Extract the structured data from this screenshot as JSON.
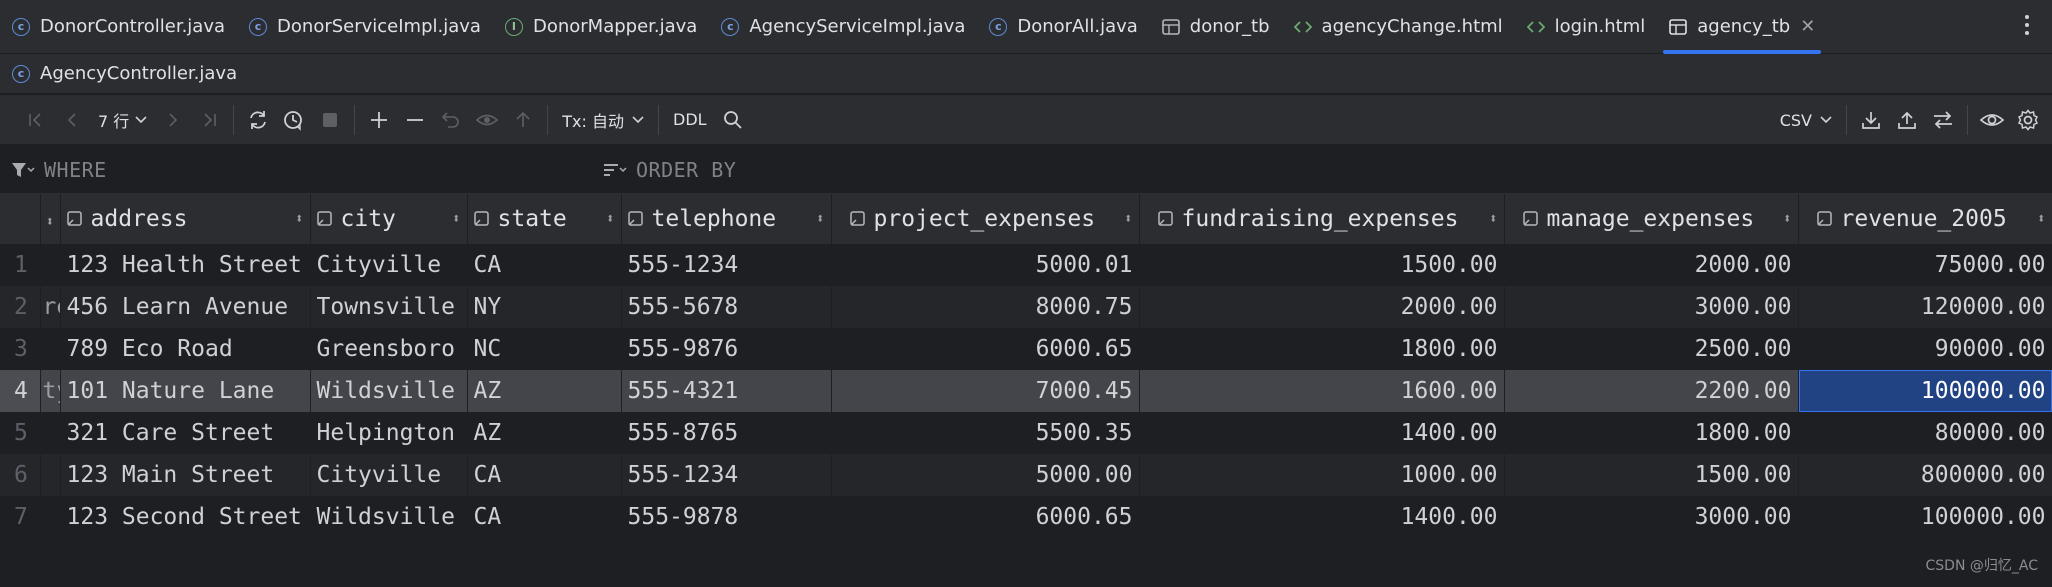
{
  "tabs": [
    {
      "label": "DonorController.java",
      "icon": "class-icon"
    },
    {
      "label": "DonorServiceImpl.java",
      "icon": "class-icon"
    },
    {
      "label": "DonorMapper.java",
      "icon": "interface-icon"
    },
    {
      "label": "AgencyServiceImpl.java",
      "icon": "class-icon"
    },
    {
      "label": "DonorAll.java",
      "icon": "class-icon"
    },
    {
      "label": "donor_tb",
      "icon": "table-icon"
    },
    {
      "label": "agencyChange.html",
      "icon": "html-icon"
    },
    {
      "label": "login.html",
      "icon": "html-icon"
    },
    {
      "label": "agency_tb",
      "icon": "table-icon",
      "active": true
    }
  ],
  "tabs_row2": [
    {
      "label": "AgencyController.java",
      "icon": "class-icon"
    }
  ],
  "toolbar": {
    "rows_label": "7 行",
    "tx_label": "Tx: 自动",
    "ddl_label": "DDL",
    "export_format": "CSV"
  },
  "filter": {
    "where_placeholder": "WHERE",
    "orderby_placeholder": "ORDER BY"
  },
  "table": {
    "columns": [
      "address",
      "city",
      "state",
      "telephone",
      "project_expenses",
      "fundraising_expenses",
      "manage_expenses",
      "revenue_2005"
    ],
    "rows": [
      {
        "n": "1",
        "hidden": "",
        "address": "123 Health Street",
        "city": "Cityville",
        "state": "CA",
        "telephone": "555-1234",
        "project_expenses": "5000.01",
        "fundraising_expenses": "1500.00",
        "manage_expenses": "2000.00",
        "revenue_2005": "75000.00"
      },
      {
        "n": "2",
        "hidden": "re",
        "address": "456 Learn Avenue",
        "city": "Townsville",
        "state": "NY",
        "telephone": "555-5678",
        "project_expenses": "8000.75",
        "fundraising_expenses": "2000.00",
        "manage_expenses": "3000.00",
        "revenue_2005": "120000.00"
      },
      {
        "n": "3",
        "hidden": "",
        "address": "789 Eco Road",
        "city": "Greensboro",
        "state": "NC",
        "telephone": "555-9876",
        "project_expenses": "6000.65",
        "fundraising_expenses": "1800.00",
        "manage_expenses": "2500.00",
        "revenue_2005": "90000.00"
      },
      {
        "n": "4",
        "hidden": "ty",
        "address": "101 Nature Lane",
        "city": "Wildsville",
        "state": "AZ",
        "telephone": "555-4321",
        "project_expenses": "7000.45",
        "fundraising_expenses": "1600.00",
        "manage_expenses": "2200.00",
        "revenue_2005": "100000.00"
      },
      {
        "n": "5",
        "hidden": "",
        "address": "321 Care Street",
        "city": "Helpington",
        "state": "AZ",
        "telephone": "555-8765",
        "project_expenses": "5500.35",
        "fundraising_expenses": "1400.00",
        "manage_expenses": "1800.00",
        "revenue_2005": "80000.00"
      },
      {
        "n": "6",
        "hidden": "",
        "address": "123 Main Street",
        "city": "Cityville",
        "state": "CA",
        "telephone": "555-1234",
        "project_expenses": "5000.00",
        "fundraising_expenses": "1000.00",
        "manage_expenses": "1500.00",
        "revenue_2005": "800000.00"
      },
      {
        "n": "7",
        "hidden": "",
        "address": "123 Second Street",
        "city": "Wildsville",
        "state": "CA",
        "telephone": "555-9878",
        "project_expenses": "6000.65",
        "fundraising_expenses": "1400.00",
        "manage_expenses": "3000.00",
        "revenue_2005": "100000.00"
      }
    ]
  },
  "watermark": "CSDN @归忆_AC"
}
